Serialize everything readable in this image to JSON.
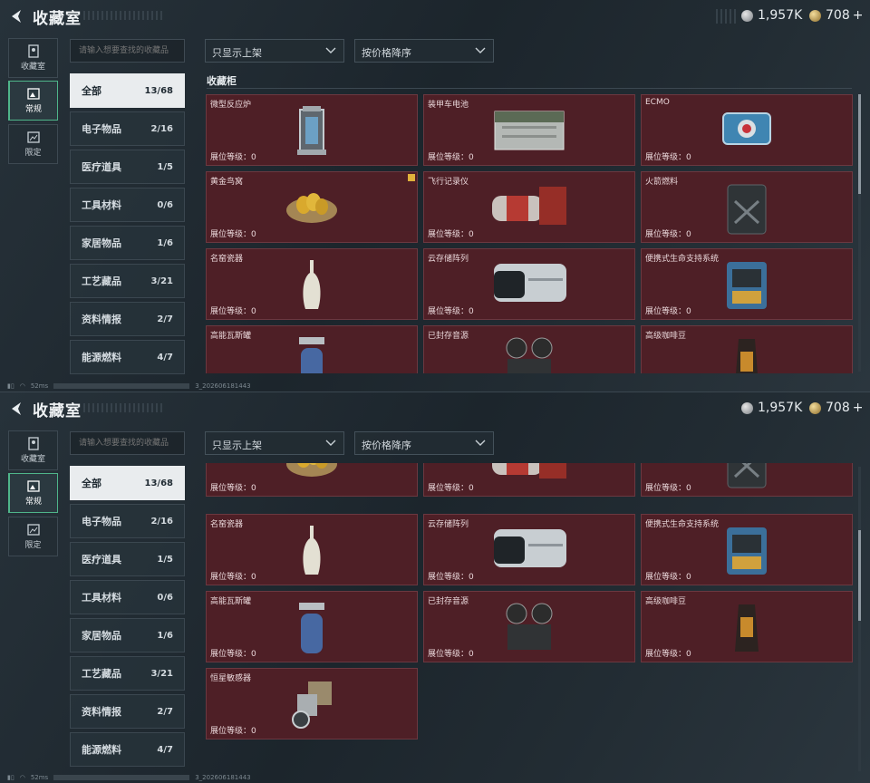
{
  "header": {
    "title": "收藏室",
    "currency_silver": "1,957K",
    "currency_gold": "708",
    "plus": "+"
  },
  "nav": [
    {
      "label": "收藏室",
      "icon": "collection-room-icon"
    },
    {
      "label": "常规",
      "icon": "regular-icon"
    },
    {
      "label": "限定",
      "icon": "limited-icon"
    }
  ],
  "search": {
    "placeholder": "请输入想要查找的收藏品"
  },
  "filters": {
    "shelf": "只显示上架",
    "sort": "按价格降序"
  },
  "categories": [
    {
      "label": "全部",
      "count": "13/68"
    },
    {
      "label": "电子物品",
      "count": "2/16"
    },
    {
      "label": "医疗道具",
      "count": "1/5"
    },
    {
      "label": "工具材料",
      "count": "0/6"
    },
    {
      "label": "家居物品",
      "count": "1/6"
    },
    {
      "label": "工艺藏品",
      "count": "3/21"
    },
    {
      "label": "资料情报",
      "count": "2/7"
    },
    {
      "label": "能源燃料",
      "count": "4/7"
    }
  ],
  "section_title": "收藏柜",
  "level_label": "展位等级：0",
  "items": [
    {
      "name": "微型反应炉",
      "icon": "reactor-icon"
    },
    {
      "name": "装甲车电池",
      "icon": "battery-icon"
    },
    {
      "name": "ECMO",
      "icon": "ecmo-icon"
    },
    {
      "name": "黄金鸟窝",
      "icon": "golden-nest-icon"
    },
    {
      "name": "飞行记录仪",
      "icon": "flight-recorder-icon"
    },
    {
      "name": "火箭燃料",
      "icon": "rocket-fuel-icon"
    },
    {
      "name": "名窑瓷器",
      "icon": "vase-icon"
    },
    {
      "name": "云存储阵列",
      "icon": "storage-array-icon"
    },
    {
      "name": "便携式生命支持系统",
      "icon": "life-support-icon"
    },
    {
      "name": "高能瓦斯罐",
      "icon": "gas-tank-icon"
    },
    {
      "name": "已封存音源",
      "icon": "reel-recorder-icon"
    },
    {
      "name": "高级咖啡豆",
      "icon": "coffee-bag-icon"
    },
    {
      "name": "恒星敏感器",
      "icon": "star-sensor-icon"
    }
  ],
  "status": {
    "ping": "52ms",
    "build": "3_202606181443"
  },
  "colors": {
    "card_bg": "#4e1f26",
    "accent": "#4fb58a"
  }
}
